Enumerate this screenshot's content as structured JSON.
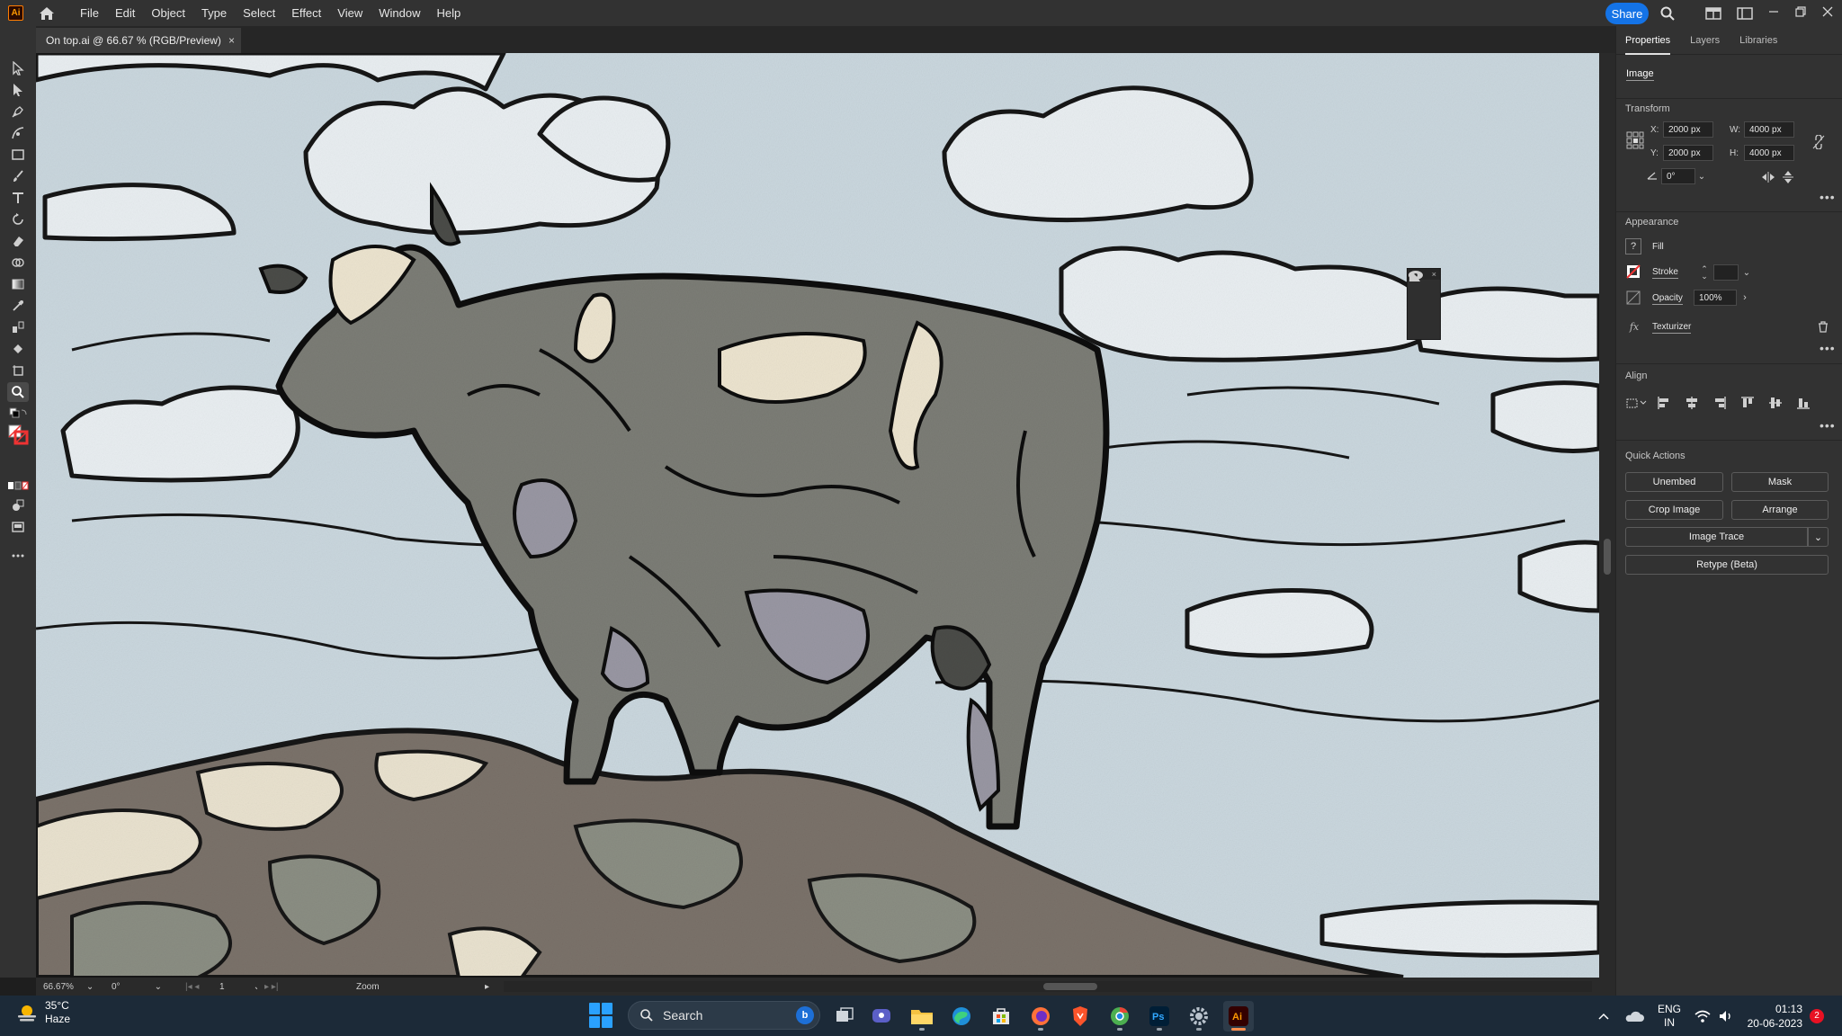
{
  "app": {
    "logo_text": "Ai"
  },
  "menu": [
    "File",
    "Edit",
    "Object",
    "Type",
    "Select",
    "Effect",
    "View",
    "Window",
    "Help"
  ],
  "share_label": "Share",
  "document": {
    "tab_title": "On top.ai @ 66.67 % (RGB/Preview)",
    "close": "×"
  },
  "status": {
    "zoom": "66.67%",
    "rotation": "0°",
    "artboard": "1",
    "tool": "Zoom"
  },
  "panel": {
    "tabs": [
      "Properties",
      "Layers",
      "Libraries"
    ],
    "selection_type": "Image",
    "transform": {
      "title": "Transform",
      "x_label": "X:",
      "x": "2000 px",
      "y_label": "Y:",
      "y": "2000 px",
      "w_label": "W:",
      "w": "4000 px",
      "h_label": "H:",
      "h": "4000 px",
      "angle": "0°"
    },
    "appearance": {
      "title": "Appearance",
      "fill_label": "Fill",
      "stroke_label": "Stroke",
      "opacity_label": "Opacity",
      "opacity": "100%",
      "effect": "Texturizer",
      "fill_unknown": "?"
    },
    "align": {
      "title": "Align"
    },
    "quick_actions": {
      "title": "Quick Actions",
      "unembed": "Unembed",
      "mask": "Mask",
      "crop": "Crop Image",
      "arrange": "Arrange",
      "trace": "Image Trace",
      "retype": "Retype (Beta)"
    }
  },
  "taskbar": {
    "temp": "35°C",
    "weather": "Haze",
    "search_placeholder": "Search",
    "lang_1": "ENG",
    "lang_2": "IN",
    "time": "01:13",
    "date": "20-06-2023",
    "notifications": "2"
  },
  "colors": {
    "accent": "#1473e6",
    "canvas_sky": "#cfdbe2",
    "panel_bg": "#323232"
  }
}
